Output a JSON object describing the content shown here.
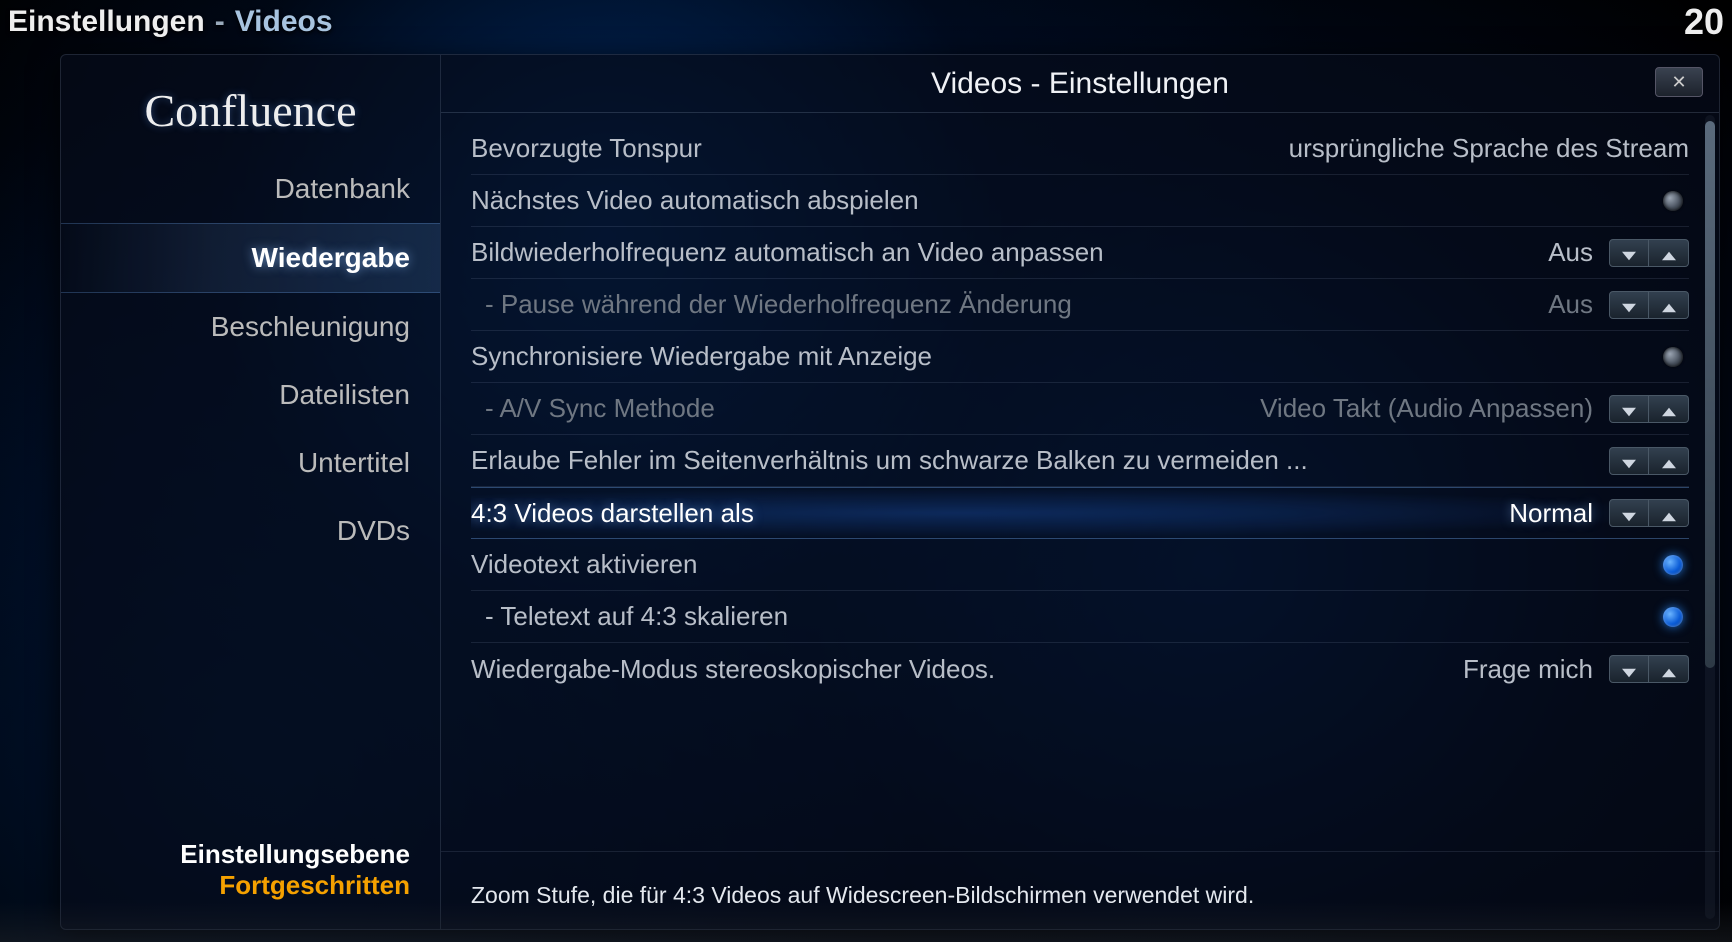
{
  "topbar": {
    "section": "Einstellungen",
    "separator": "-",
    "subsection": "Videos",
    "clock": "20"
  },
  "logo": "Confluence",
  "sidebar": {
    "items": [
      {
        "label": "Datenbank",
        "active": false
      },
      {
        "label": "Wiedergabe",
        "active": true
      },
      {
        "label": "Beschleunigung",
        "active": false
      },
      {
        "label": "Dateilisten",
        "active": false
      },
      {
        "label": "Untertitel",
        "active": false
      },
      {
        "label": "DVDs",
        "active": false
      }
    ],
    "footer": {
      "label": "Einstellungsebene",
      "value": "Fortgeschritten"
    }
  },
  "main": {
    "title": "Videos - Einstellungen",
    "rows": [
      {
        "id": "pref-audio-lang",
        "label": "Bevorzugte Tonspur",
        "type": "value",
        "value": "ursprüngliche Sprache des Stream",
        "dim": false,
        "sub": false,
        "sel": false
      },
      {
        "id": "auto-play-next",
        "label": "Nächstes Video automatisch abspielen",
        "type": "toggle",
        "on": false,
        "dim": false,
        "sub": false,
        "sel": false
      },
      {
        "id": "adjust-refresh",
        "label": "Bildwiederholfrequenz automatisch an Video anpassen",
        "type": "spinner",
        "value": "Aus",
        "dim": false,
        "sub": false,
        "sel": false
      },
      {
        "id": "pause-during-refresh",
        "label": "- Pause während der Wiederholfrequenz Änderung",
        "type": "spinner",
        "value": "Aus",
        "dim": true,
        "sub": true,
        "sel": false
      },
      {
        "id": "sync-playback",
        "label": "Synchronisiere Wiedergabe mit Anzeige",
        "type": "toggle",
        "on": false,
        "dim": false,
        "sub": false,
        "sel": false
      },
      {
        "id": "av-sync-method",
        "label": "- A/V Sync Methode",
        "type": "spinner",
        "value": "Video Takt (Audio Anpassen)",
        "dim": true,
        "sub": true,
        "sel": false
      },
      {
        "id": "aspect-error",
        "label": "Erlaube Fehler im Seitenverhältnis um schwarze Balken zu vermeiden   ...",
        "type": "spinner",
        "value": "",
        "dim": false,
        "sub": false,
        "sel": false
      },
      {
        "id": "display-4-3",
        "label": "4:3 Videos darstellen als",
        "type": "spinner",
        "value": "Normal",
        "dim": false,
        "sub": false,
        "sel": true
      },
      {
        "id": "teletext-enable",
        "label": "Videotext aktivieren",
        "type": "toggle",
        "on": true,
        "dim": false,
        "sub": false,
        "sel": false
      },
      {
        "id": "teletext-scale",
        "label": "- Teletext auf 4:3 skalieren",
        "type": "toggle",
        "on": true,
        "dim": false,
        "sub": true,
        "sel": false
      },
      {
        "id": "stereo-mode",
        "label": "Wiedergabe-Modus stereoskopischer Videos.",
        "type": "spinner",
        "value": "Frage mich",
        "dim": false,
        "sub": false,
        "sel": false
      }
    ],
    "description": "Zoom Stufe, die für 4:3 Videos auf Widescreen-Bildschirmen verwendet wird."
  }
}
